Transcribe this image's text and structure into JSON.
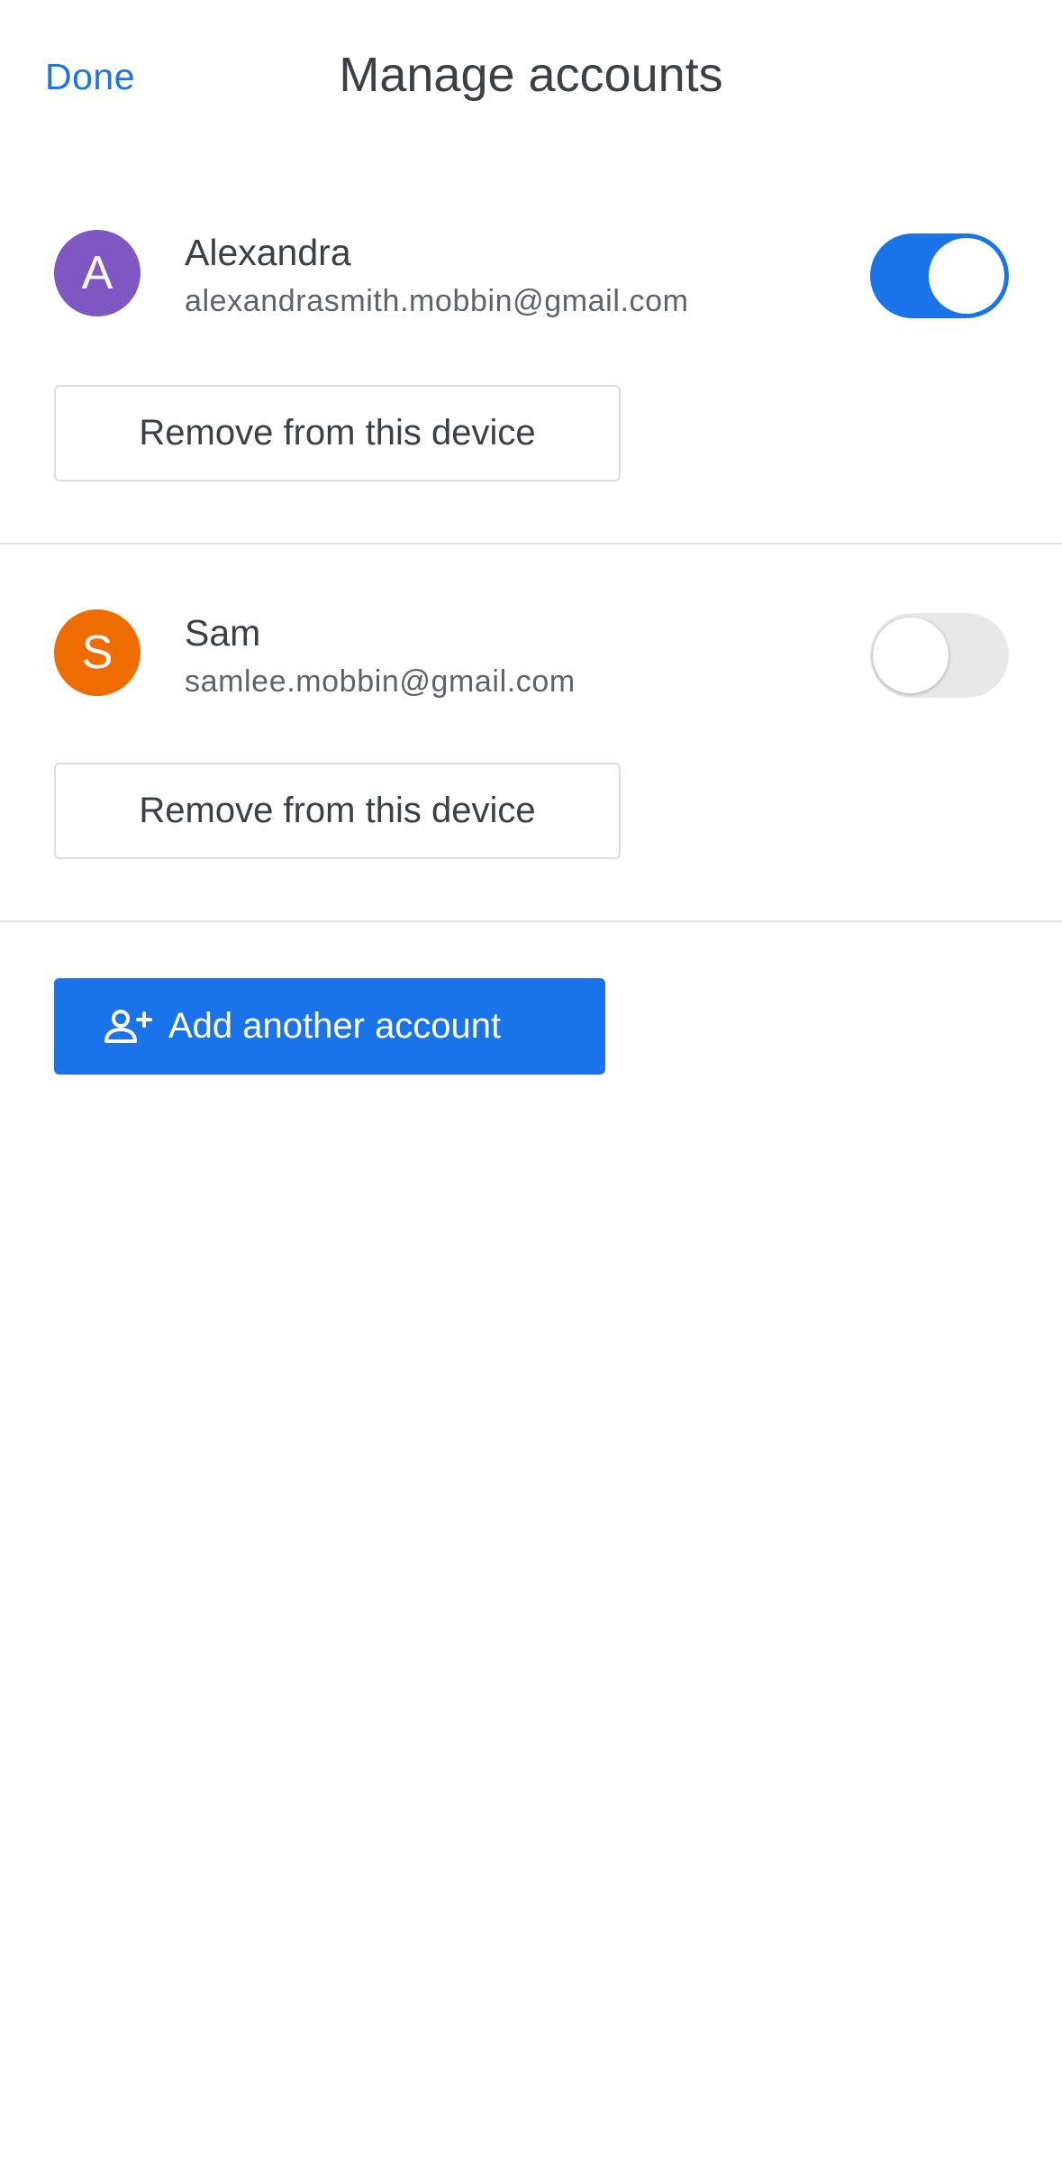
{
  "header": {
    "done_label": "Done",
    "title": "Manage accounts"
  },
  "accounts": [
    {
      "initial": "A",
      "name": "Alexandra",
      "email": "alexandrasmith.mobbin@gmail.com",
      "avatar_color": "#7e57c2",
      "toggle_on": true,
      "remove_label": "Remove from this device"
    },
    {
      "initial": "S",
      "name": "Sam",
      "email": "samlee.mobbin@gmail.com",
      "avatar_color": "#ef6c00",
      "toggle_on": false,
      "remove_label": "Remove from this device"
    }
  ],
  "add_account": {
    "label": "Add another account",
    "icon": "add-person-icon"
  },
  "colors": {
    "accent": "#1a73e8",
    "text": "#3c4043",
    "secondary_text": "#5f6368",
    "divider": "#e3e3e3"
  }
}
